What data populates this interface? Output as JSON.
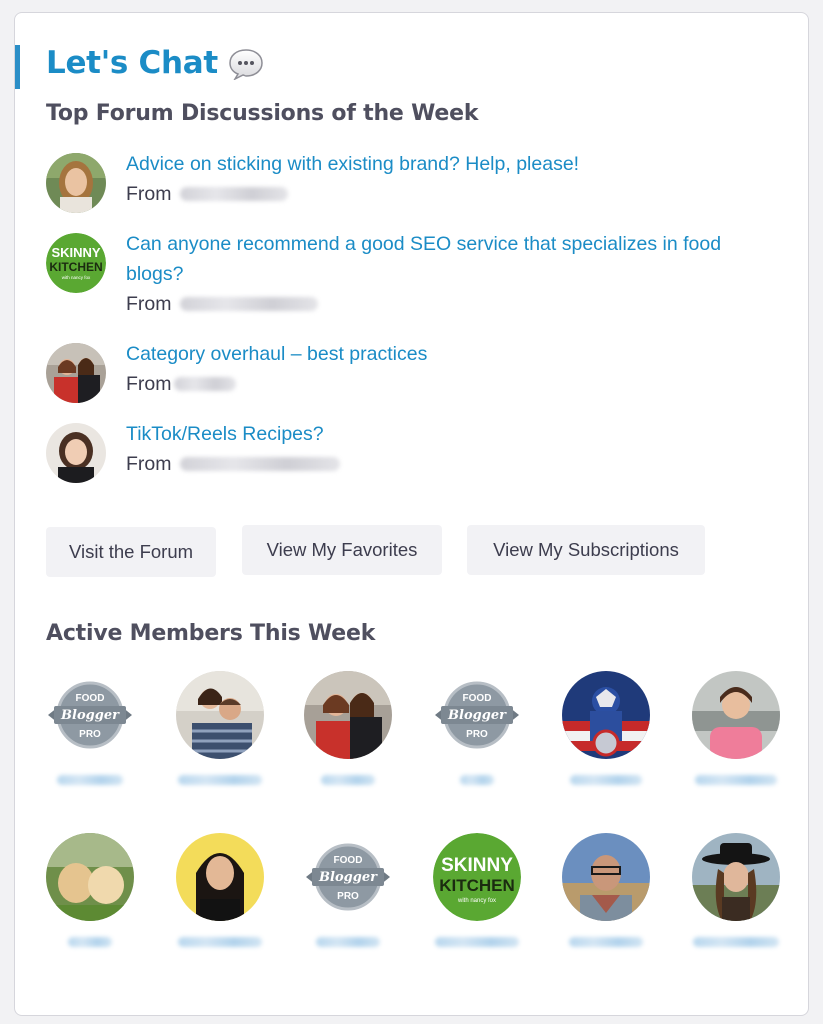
{
  "widget": {
    "title": "Let's Chat",
    "title_icon": "speech-bubble-icon",
    "accent_color": "#1b8cc6"
  },
  "discussions_heading": "Top Forum Discussions of the Week",
  "discussions": [
    {
      "title": "Advice on sticking with existing brand? Help, please!",
      "from_label": "From",
      "avatar": "photo-woman-blonde"
    },
    {
      "title": "Can anyone recommend a good SEO service that specializes in food blogs?",
      "from_label": "From",
      "avatar": "skinny-kitchen-logo"
    },
    {
      "title": "Category overhaul – best practices",
      "from_label": "From",
      "avatar": "photo-two-women"
    },
    {
      "title": "TikTok/Reels Recipes?",
      "from_label": "From",
      "avatar": "photo-woman-dark-hair"
    }
  ],
  "buttons": {
    "visit_forum": "Visit the Forum",
    "view_favorites": "View My Favorites",
    "view_subscriptions": "View My Subscriptions"
  },
  "members_heading": "Active Members This Week",
  "badge": {
    "line1": "FOOD",
    "line2": "Blogger",
    "line3": "PRO"
  },
  "skinny_logo": {
    "line1": "SKINNY",
    "line2": "KITCHEN",
    "line3": "with nancy fox"
  },
  "members": [
    {
      "avatar": "food-blogger-pro-badge"
    },
    {
      "avatar": "photo-couple"
    },
    {
      "avatar": "photo-two-women"
    },
    {
      "avatar": "food-blogger-pro-badge"
    },
    {
      "avatar": "photo-captain-america"
    },
    {
      "avatar": "photo-woman-pink-shirt"
    },
    {
      "avatar": "photo-dogs"
    },
    {
      "avatar": "photo-woman-yellow-bg"
    },
    {
      "avatar": "food-blogger-pro-badge"
    },
    {
      "avatar": "skinny-kitchen-logo"
    },
    {
      "avatar": "photo-man-glasses"
    },
    {
      "avatar": "photo-person-black-hat"
    }
  ]
}
